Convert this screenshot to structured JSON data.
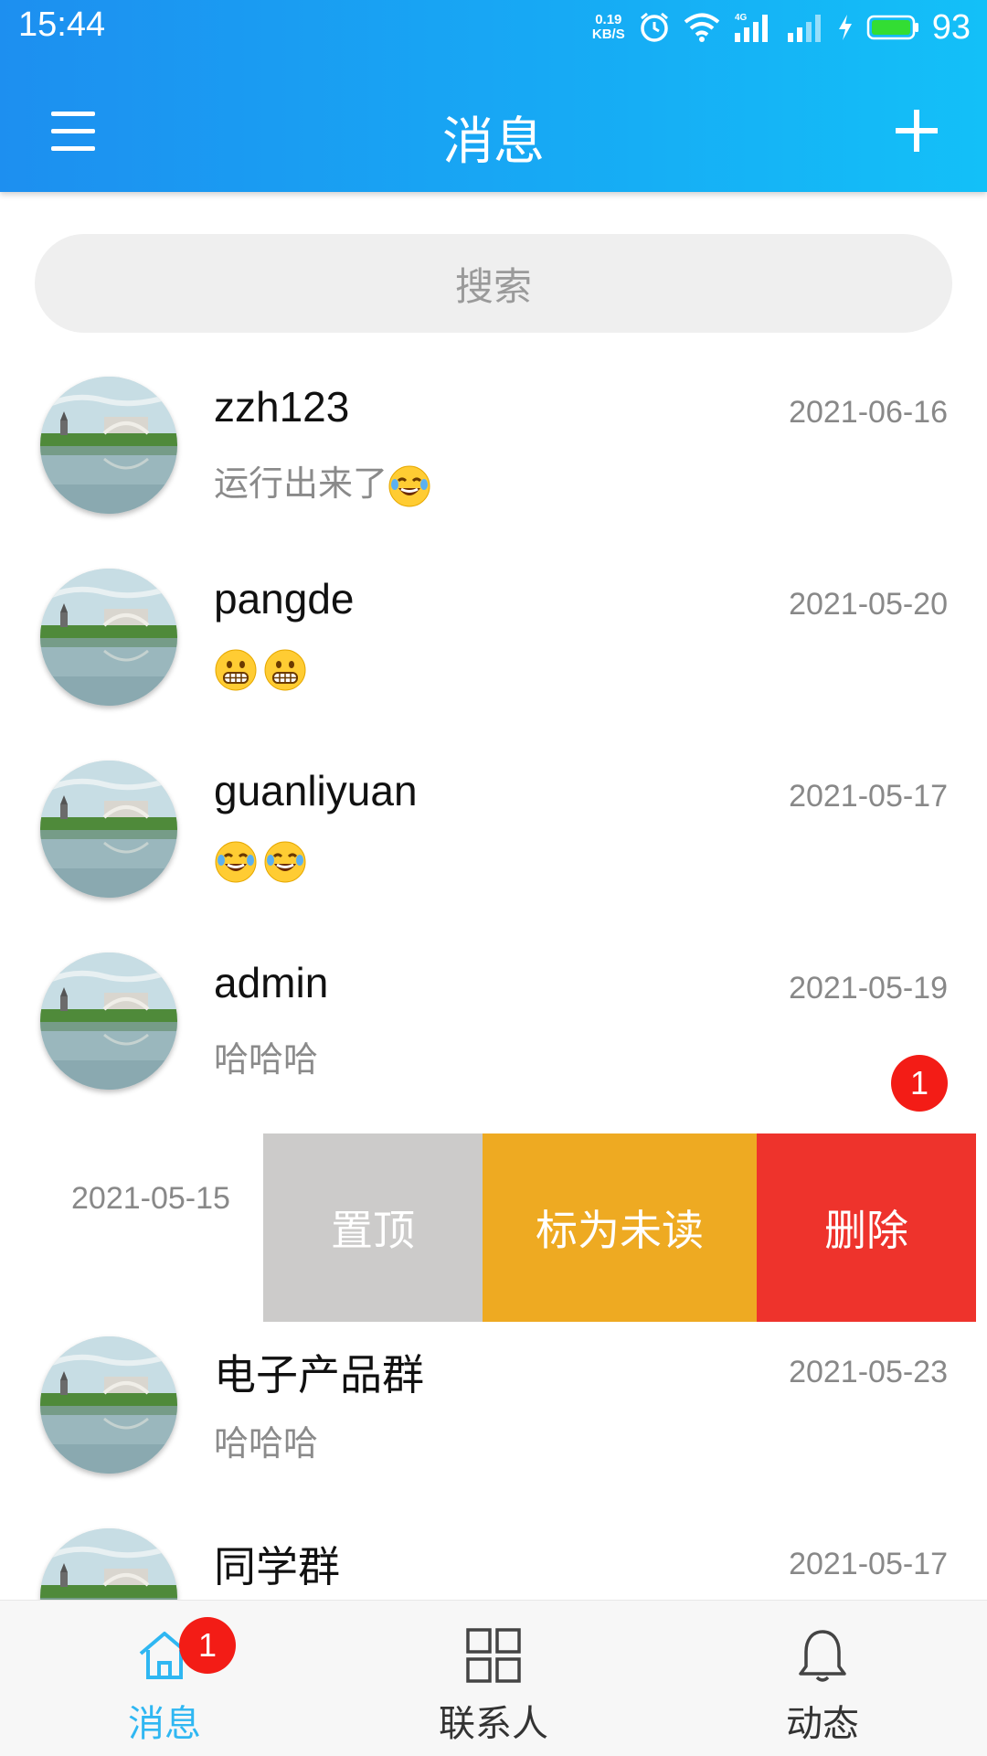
{
  "status_bar": {
    "time": "15:44",
    "net_speed_value": "0.19",
    "net_speed_unit": "KB/S",
    "network_type": "4G",
    "battery_percent": "93",
    "icons": [
      "alarm-icon",
      "wifi-icon",
      "signal-icon",
      "charging-icon",
      "battery-icon"
    ]
  },
  "app_bar": {
    "title": "消息",
    "menu_icon": "hamburger-menu-icon",
    "add_icon": "plus-icon"
  },
  "search": {
    "placeholder": "搜索"
  },
  "conversations": [
    {
      "name": "zzh123",
      "date": "2021-06-16",
      "message": "运行出来了",
      "emojis": [
        "tears-of-joy"
      ]
    },
    {
      "name": "pangde",
      "date": "2021-05-20",
      "message": "",
      "emojis": [
        "grimacing",
        "grimacing"
      ]
    },
    {
      "name": "guanliyuan",
      "date": "2021-05-17",
      "message": "",
      "emojis": [
        "tears-of-joy",
        "tears-of-joy"
      ]
    },
    {
      "name": "admin",
      "date": "2021-05-19",
      "message": "哈哈哈",
      "emojis": [],
      "unread": "1"
    }
  ],
  "swiped_row": {
    "date": "2021-05-15",
    "actions": {
      "pin": "置顶",
      "mark_unread": "标为未读",
      "delete": "删除"
    }
  },
  "conversations_after": [
    {
      "name": "电子产品群",
      "date": "2021-05-23",
      "message": "哈哈哈"
    },
    {
      "name": "同学群",
      "date": "2021-05-17",
      "message": ""
    }
  ],
  "bottom_nav": {
    "tabs": [
      {
        "label": "消息",
        "icon": "home-icon",
        "active": true,
        "badge": "1"
      },
      {
        "label": "联系人",
        "icon": "grid-icon",
        "active": false
      },
      {
        "label": "动态",
        "icon": "bell-icon",
        "active": false
      }
    ],
    "active_color": "#2fb7f2",
    "inactive_color": "#333333"
  },
  "colors": {
    "header_gradient": [
      "#1d8ff0",
      "#13c0f8"
    ],
    "badge": "#f31c16",
    "pin_action": "#cccbca",
    "unread_action": "#eeaa22",
    "delete_action": "#ee332c"
  }
}
